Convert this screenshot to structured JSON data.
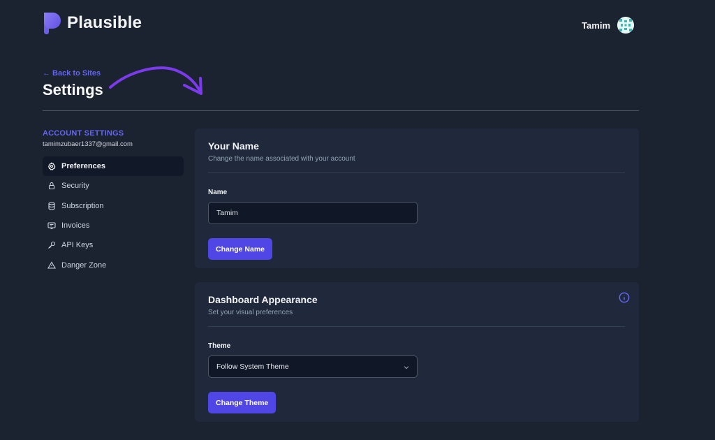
{
  "header": {
    "brand": "Plausible",
    "user_name": "Tamim"
  },
  "page": {
    "back_link": "← Back to Sites",
    "title": "Settings"
  },
  "sidebar": {
    "heading": "ACCOUNT SETTINGS",
    "email": "tamimzubaer1337@gmail.com",
    "items": [
      {
        "label": "Preferences",
        "icon": "gear-icon",
        "active": true
      },
      {
        "label": "Security",
        "icon": "lock-icon",
        "active": false
      },
      {
        "label": "Subscription",
        "icon": "database-icon",
        "active": false
      },
      {
        "label": "Invoices",
        "icon": "receipt-icon",
        "active": false
      },
      {
        "label": "API Keys",
        "icon": "key-icon",
        "active": false
      },
      {
        "label": "Danger Zone",
        "icon": "warning-icon",
        "active": false
      }
    ]
  },
  "name_card": {
    "title": "Your Name",
    "subtitle": "Change the name associated with your account",
    "field_label": "Name",
    "field_value": "Tamim",
    "button_label": "Change Name"
  },
  "appearance_card": {
    "title": "Dashboard Appearance",
    "subtitle": "Set your visual preferences",
    "field_label": "Theme",
    "selected_theme": "Follow System Theme",
    "button_label": "Change Theme"
  },
  "colors": {
    "accent": "#6366f1",
    "button": "#4f46e5",
    "background": "#1b2230",
    "card": "#1f293b"
  }
}
